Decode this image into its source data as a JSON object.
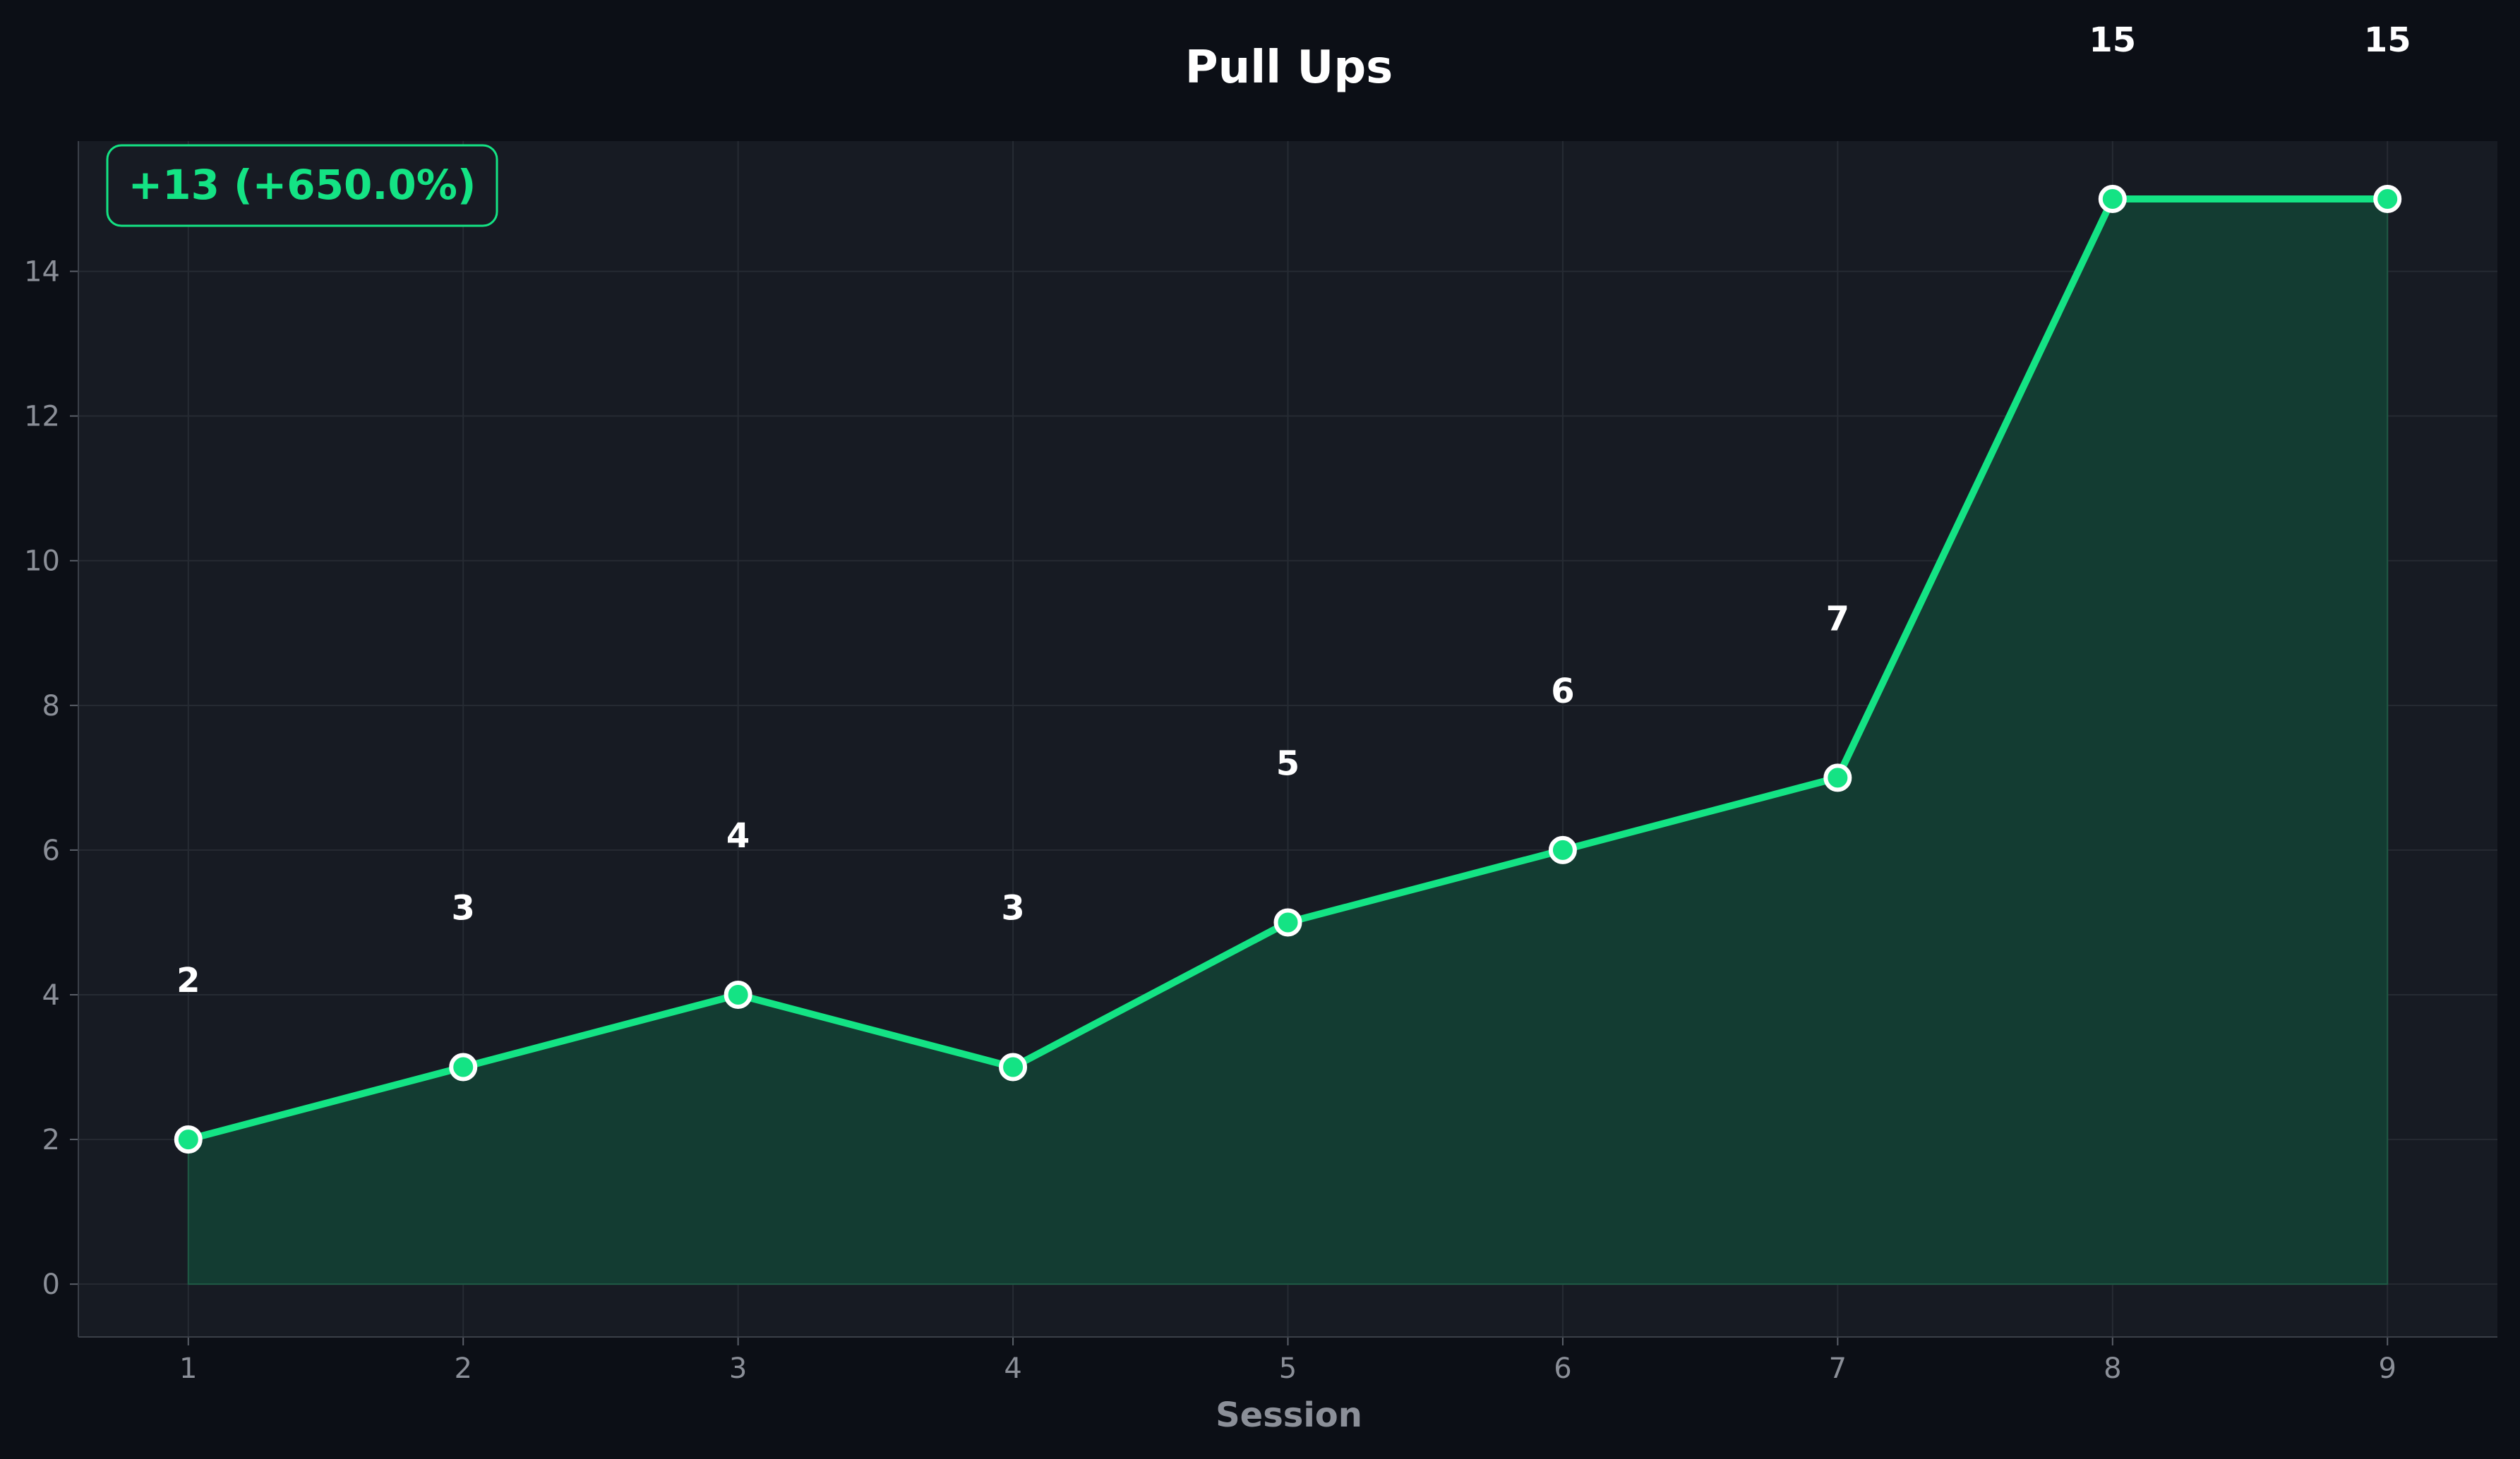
{
  "chart_data": {
    "type": "line",
    "title": "Pull Ups",
    "xlabel": "Session",
    "ylabel": "",
    "x": [
      1,
      2,
      3,
      4,
      5,
      6,
      7,
      8,
      9
    ],
    "series": [
      {
        "values": [
          2,
          3,
          4,
          3,
          5,
          6,
          7,
          15,
          15
        ]
      }
    ],
    "data_labels": [
      "2",
      "3",
      "4",
      "3",
      "5",
      "6",
      "7",
      "15",
      "15"
    ],
    "xticks": [
      "1",
      "2",
      "3",
      "4",
      "5",
      "6",
      "7",
      "8",
      "9"
    ],
    "yticks": [
      "0",
      "2",
      "4",
      "6",
      "8",
      "10",
      "12",
      "14"
    ],
    "xlim": [
      0.6,
      9.4
    ],
    "ylim": [
      -0.73,
      15.8
    ],
    "grid": true,
    "fill_area": true,
    "annotation": "+13 (+650.0%)",
    "colors": {
      "line": "#14e384",
      "fill": "#133c32",
      "plot_background": "#171b23",
      "page_background": "#0c0f16",
      "grid": "#262b33",
      "text": "#ffffff",
      "tick_text": "#8b8f98"
    }
  }
}
